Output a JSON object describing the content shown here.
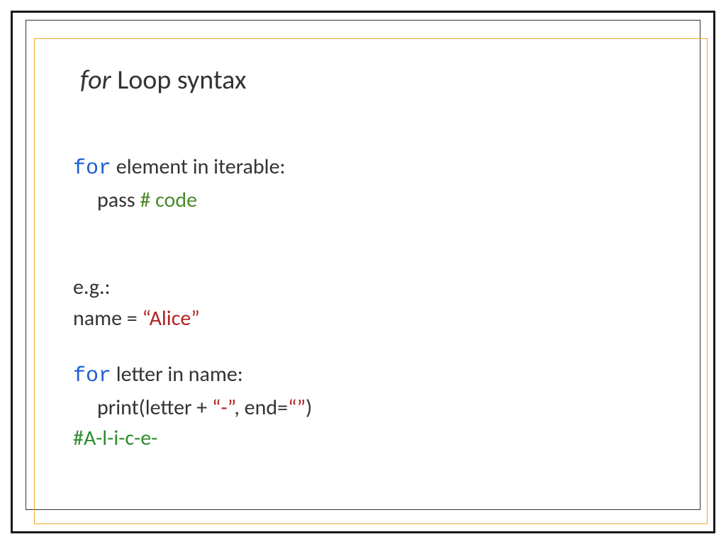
{
  "title": {
    "italic_part": "for",
    "rest": " Loop syntax"
  },
  "syntax": {
    "keyword": "for",
    "line1_rest": " element in iterable:",
    "line2_pass": "pass ",
    "line2_comment": "# code"
  },
  "example": {
    "label": "e.g.:",
    "assign_left": "name = ",
    "assign_string": "“Alice”",
    "for_keyword": "for",
    "for_rest": " letter in name:",
    "print_left": "print(letter + ",
    "print_str1": "“-”",
    "print_mid": ", end=",
    "print_str2": "“”",
    "print_right": ")",
    "output": "#A-l-i-c-e-"
  }
}
